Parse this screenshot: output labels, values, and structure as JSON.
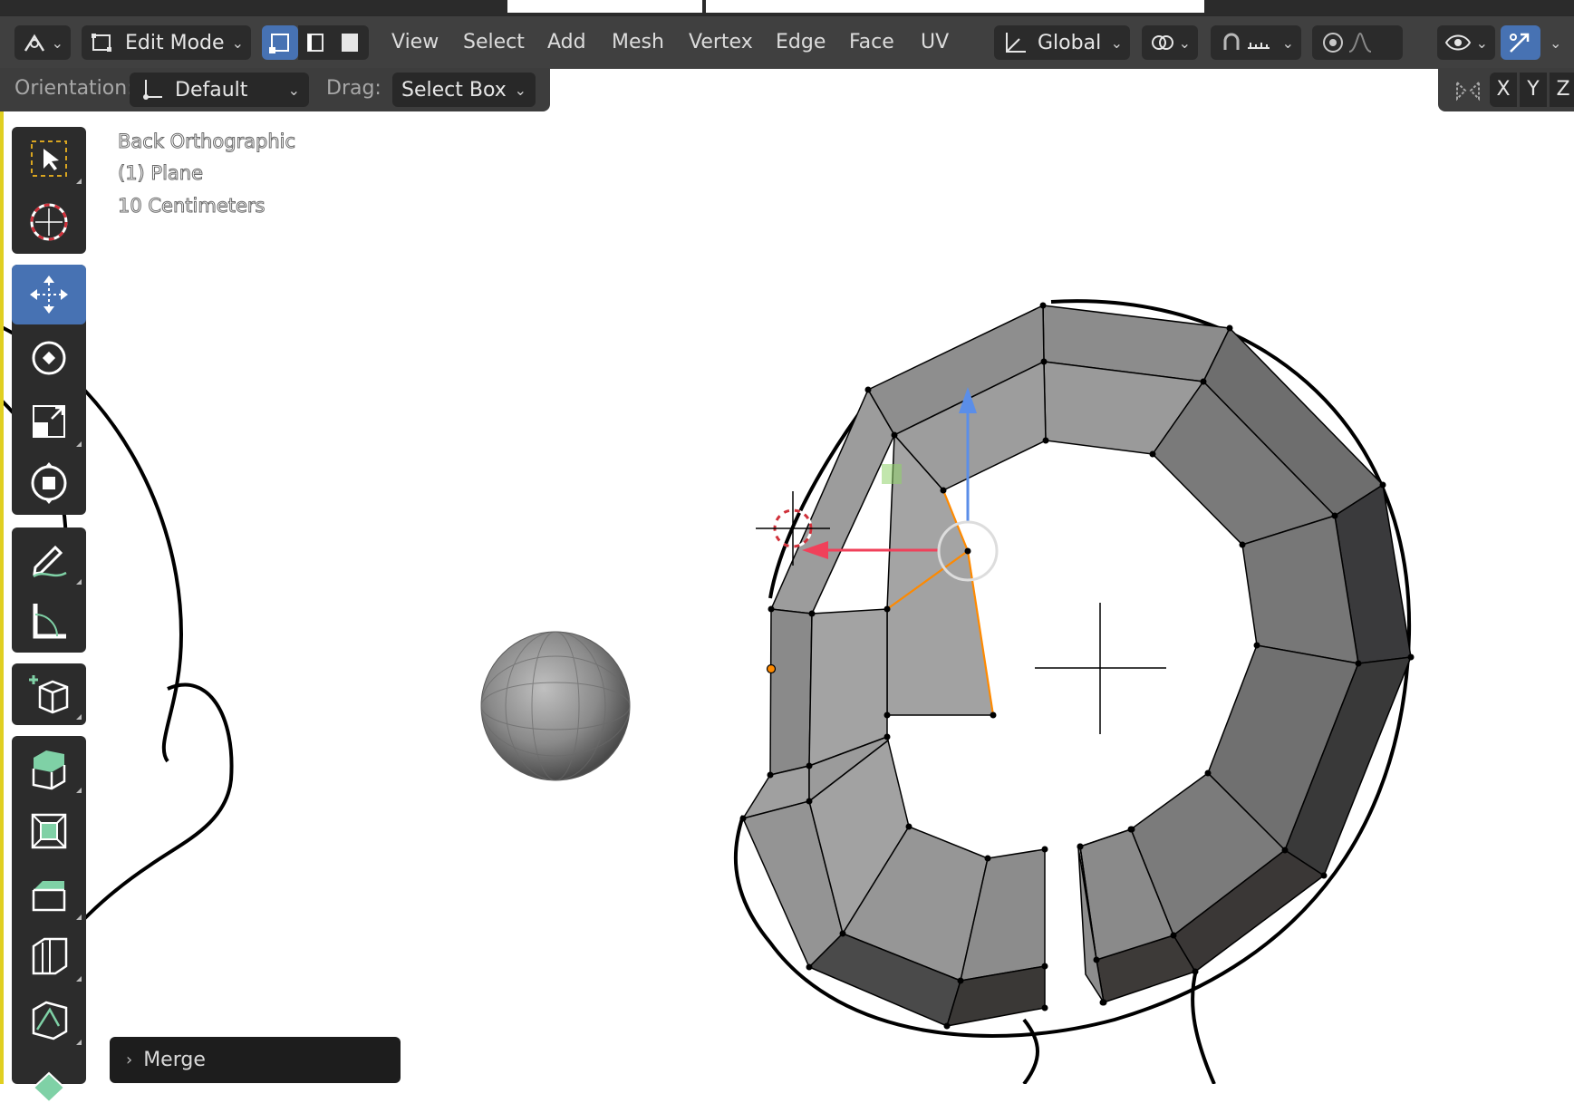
{
  "header": {
    "mode_label": "Edit Mode",
    "menus": [
      "View",
      "Select",
      "Add",
      "Mesh",
      "Vertex",
      "Edge",
      "Face",
      "UV"
    ],
    "transform_orientation": "Global"
  },
  "tool_settings": {
    "orientation_label": "Orientation:",
    "orientation_value": "Default",
    "drag_label": "Drag:",
    "drag_value": "Select Box",
    "axes": [
      "X",
      "Y",
      "Z"
    ]
  },
  "viewport": {
    "view_name": "Back Orthographic",
    "object_name": "(1) Plane",
    "scale": "10 Centimeters"
  },
  "last_operator": {
    "label": "Merge"
  },
  "toolbar": {
    "tools": [
      "select-box-tool",
      "cursor-tool",
      "move-tool",
      "rotate-tool",
      "scale-tool",
      "transform-tool",
      "annotate-tool",
      "measure-tool",
      "add-cube-tool",
      "extrude-tool",
      "inset-tool",
      "bevel-tool",
      "loop-cut-tool",
      "knife-tool",
      "poly-build-tool"
    ],
    "active_tool": "move-tool"
  },
  "colors": {
    "header_bg": "#404040",
    "active_blue": "#4772b3",
    "mesh_face": "#8e8e8e",
    "mesh_face_dark": "#3c3c3c",
    "selection_orange": "#ff8a00",
    "gizmo_x": "#f0415a",
    "gizmo_z": "#5b8ee8"
  }
}
